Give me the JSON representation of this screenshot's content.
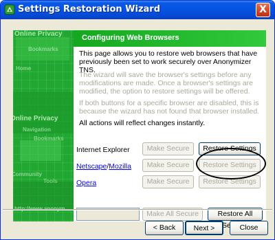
{
  "window": {
    "title": "Settings Restoration Wizard",
    "close_label": "X"
  },
  "panel": {
    "header": "Configuring Web Browsers",
    "intro": "This page allows you to restore web browsers that have previously been set to work securely over Anonymizer TNS.",
    "info1": "The wizard will save the browser's settings before any modifications are made. Once a browser's settings are modified, the option to restore settings will be offered.",
    "info2": "If both buttons for a specific browser are disabled, this is because the wizard has not found that browser installed.",
    "note": "All actions will reflect changes instantly."
  },
  "browsers": [
    {
      "name": "Internet Explorer",
      "make_secure": "Make Secure",
      "restore": "Restore Settings"
    },
    {
      "name_part1": "Netscape",
      "separator": "/",
      "name_part2": "Mozilla",
      "make_secure": "Make Secure",
      "restore": "Restore Settings"
    },
    {
      "name": "Opera",
      "make_secure": "Make Secure",
      "restore": "Restore Settings"
    }
  ],
  "all": {
    "make_all": "Make All Secure",
    "restore_all": "Restore All Settings"
  },
  "side_image": {
    "texts": [
      "Online Privacy",
      "Bookmarks",
      "Home",
      "Online Privacy",
      "Navigation",
      "Bookmarks",
      "Community",
      "Tools",
      "http://www.anonym"
    ]
  },
  "nav": {
    "back": "< Back",
    "next": "Next >",
    "close": "Close"
  },
  "colors": {
    "titlebar": "#0553e1",
    "banner_green": "#2ab53a",
    "face": "#ece9d8"
  }
}
